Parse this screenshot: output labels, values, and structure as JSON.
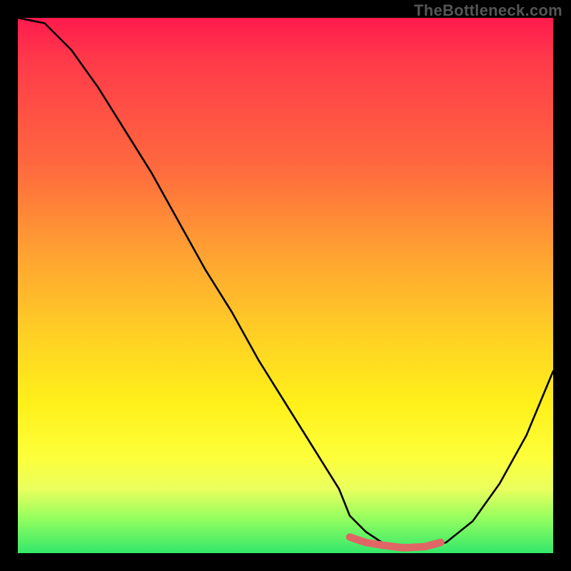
{
  "watermark": "TheBottleneck.com",
  "chart_data": {
    "type": "line",
    "title": "",
    "xlabel": "",
    "ylabel": "",
    "xlim": [
      0,
      100
    ],
    "ylim": [
      0,
      100
    ],
    "series": [
      {
        "name": "curve",
        "x": [
          0,
          5,
          10,
          15,
          20,
          25,
          30,
          35,
          40,
          45,
          50,
          55,
          60,
          62,
          65,
          68,
          72,
          76,
          80,
          85,
          90,
          95,
          100
        ],
        "values": [
          100,
          99,
          94,
          87,
          79,
          71,
          62,
          53,
          45,
          36,
          28,
          20,
          12,
          7,
          4,
          2,
          1,
          1,
          2,
          6,
          13,
          22,
          34
        ]
      },
      {
        "name": "highlight-range",
        "x": [
          62,
          65,
          68,
          72,
          76,
          79
        ],
        "values": [
          3,
          2,
          1.5,
          1,
          1.2,
          2
        ]
      }
    ],
    "background": {
      "type": "vertical-gradient",
      "stops": [
        {
          "pos": 0.0,
          "color": "#ff1a4d"
        },
        {
          "pos": 0.28,
          "color": "#ff6a3e"
        },
        {
          "pos": 0.6,
          "color": "#ffd224"
        },
        {
          "pos": 0.82,
          "color": "#fdff3a"
        },
        {
          "pos": 1.0,
          "color": "#33e86b"
        }
      ]
    }
  }
}
